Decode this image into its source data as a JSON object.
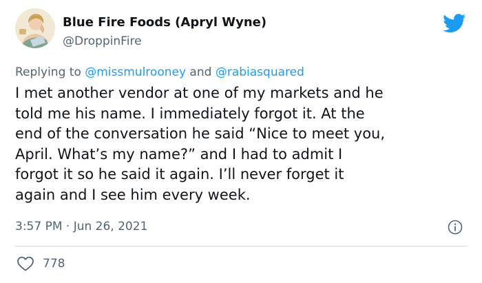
{
  "author": {
    "display_name": "Blue Fire Foods (Apryl Wyne)",
    "handle": "@DroppinFire"
  },
  "reply_context": {
    "prefix": "Replying to ",
    "mention_1": "@missmulrooney",
    "conjunction": " and ",
    "mention_2": "@rabiasquared"
  },
  "tweet": {
    "lines": [
      "I met another vendor at one of my markets and he",
      "told me his name. I immediately forgot it. At the",
      "end of the conversation he said “Nice to meet you,",
      "April. What’s my name?” and I had to admit I",
      "forgot it so he said it again. I’ll never forget it",
      "again and I see him every week."
    ],
    "timestamp": "3:57 PM · Jun 26, 2021",
    "likes": "778"
  },
  "colors": {
    "twitter_blue": "#1d9bf0",
    "secondary_text": "#536471",
    "divider": "#cfd9de"
  },
  "icons": {
    "logo": "twitter-bird-icon",
    "info": "info-icon",
    "like": "heart-icon"
  }
}
